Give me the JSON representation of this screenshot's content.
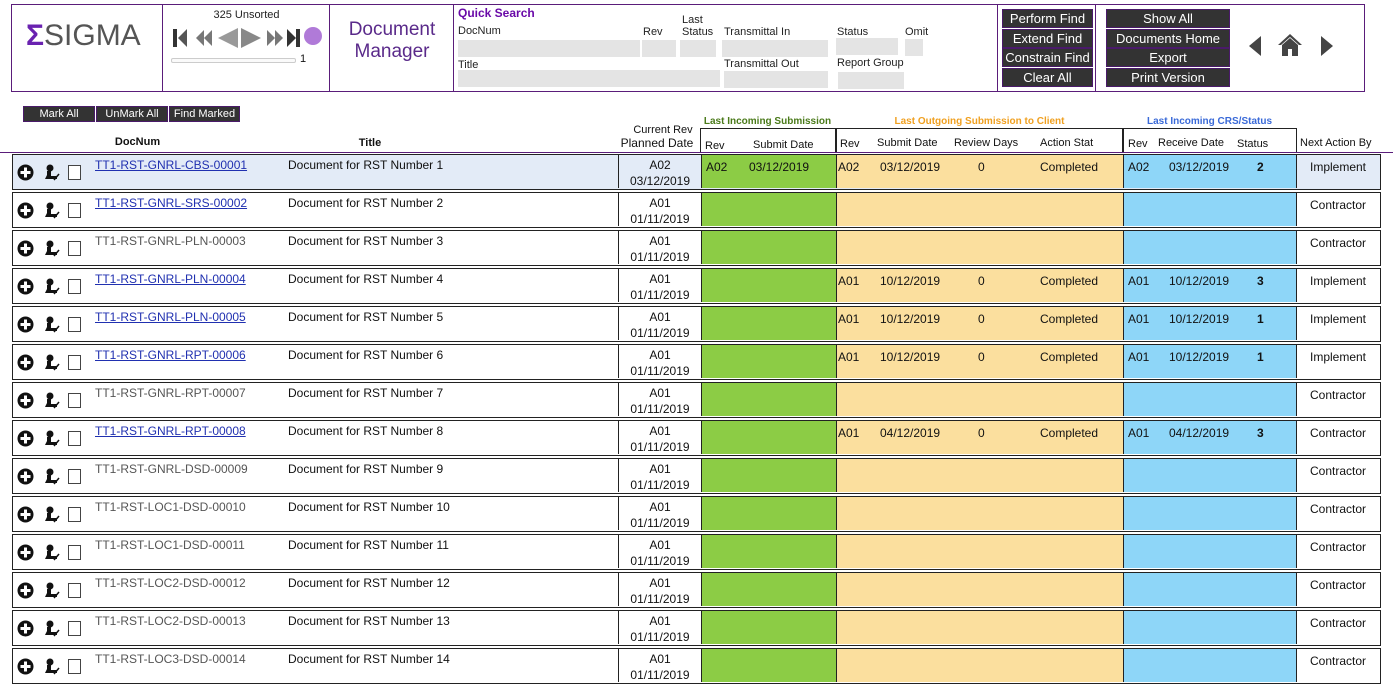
{
  "header": {
    "logo_sigma": "Σ",
    "logo_text": "SIGMA",
    "record_status": "325 Unsorted",
    "record_number": "1",
    "app_title_line1": "Document",
    "app_title_line2": "Manager"
  },
  "quick_search": {
    "title": "Quick Search",
    "labels": {
      "docnum": "DocNum",
      "rev": "Rev",
      "last_status_1": "Last",
      "last_status_2": "Status",
      "transmittal_in": "Transmittal In",
      "status": "Status",
      "omit": "Omit",
      "title": "Title",
      "transmittal_out": "Transmittal Out",
      "report_group": "Report Group"
    },
    "values": {
      "docnum": "",
      "rev": "",
      "last_status": "",
      "transmittal_in": "",
      "status": "",
      "omit": "",
      "title": "",
      "transmittal_out": "",
      "report_group": ""
    }
  },
  "find_buttons": [
    "Perform Find",
    "Extend Find",
    "Constrain Find",
    "Clear All"
  ],
  "action_buttons": [
    "Show All",
    "Documents Home",
    "Export",
    "Print Version"
  ],
  "icons": {
    "nav_prev": "triangle-left-icon",
    "home": "home-icon",
    "nav_next": "triangle-right-icon"
  },
  "mark_buttons": [
    "Mark All",
    "UnMark All",
    "Find Marked"
  ],
  "columns": {
    "docnum": "DocNum",
    "title": "Title",
    "current_rev": "Current Rev",
    "planned_date": "Planned Date",
    "group_incoming": "Last Incoming Submission",
    "group_outgoing": "Last Outgoing Submission to Client",
    "group_crs": "Last Incoming CRS/Status",
    "in_rev": "Rev",
    "in_submit_date": "Submit Date",
    "out_rev": "Rev",
    "out_submit_date": "Submit Date",
    "out_review_days": "Review Days",
    "out_action_stat": "Action Stat",
    "crs_rev": "Rev",
    "crs_receive_date": "Receive Date",
    "crs_status": "Status",
    "next_action_by": "Next Action By"
  },
  "colors": {
    "brand_purple": "#5a1d7a",
    "incoming_green": "#8ccc45",
    "outgoing_orange": "#fbdf9e",
    "crs_blue": "#8ed6f8",
    "incoming_header": "#4a7a1a",
    "outgoing_header": "#f0a020",
    "crs_header": "#3a6ad8"
  },
  "rows": [
    {
      "docnum": "TT1-RST-GNRL-CBS-00001",
      "link": true,
      "title": "Document for RST Number 1",
      "cur_rev": "A02",
      "planned": "03/12/2019",
      "in_rev": "A02",
      "in_date": "03/12/2019",
      "out_rev": "A02",
      "out_date": "03/12/2019",
      "out_days": "0",
      "out_stat": "Completed",
      "crs_rev": "A02",
      "crs_date": "03/12/2019",
      "crs_status": "2",
      "next": "Implement"
    },
    {
      "docnum": "TT1-RST-GNRL-SRS-00002",
      "link": true,
      "title": "Document for RST Number 2",
      "cur_rev": "A01",
      "planned": "01/11/2019",
      "in_rev": "",
      "in_date": "",
      "out_rev": "",
      "out_date": "",
      "out_days": "",
      "out_stat": "",
      "crs_rev": "",
      "crs_date": "",
      "crs_status": "",
      "next": "Contractor"
    },
    {
      "docnum": "TT1-RST-GNRL-PLN-00003",
      "link": false,
      "title": "Document for RST Number 3",
      "cur_rev": "A01",
      "planned": "01/11/2019",
      "in_rev": "",
      "in_date": "",
      "out_rev": "",
      "out_date": "",
      "out_days": "",
      "out_stat": "",
      "crs_rev": "",
      "crs_date": "",
      "crs_status": "",
      "next": "Contractor"
    },
    {
      "docnum": "TT1-RST-GNRL-PLN-00004",
      "link": true,
      "title": "Document for RST Number 4",
      "cur_rev": "A01",
      "planned": "01/11/2019",
      "in_rev": "",
      "in_date": "",
      "out_rev": "A01",
      "out_date": "10/12/2019",
      "out_days": "0",
      "out_stat": "Completed",
      "crs_rev": "A01",
      "crs_date": "10/12/2019",
      "crs_status": "3",
      "next": "Implement"
    },
    {
      "docnum": "TT1-RST-GNRL-PLN-00005",
      "link": true,
      "title": "Document for RST Number 5",
      "cur_rev": "A01",
      "planned": "01/11/2019",
      "in_rev": "",
      "in_date": "",
      "out_rev": "A01",
      "out_date": "10/12/2019",
      "out_days": "0",
      "out_stat": "Completed",
      "crs_rev": "A01",
      "crs_date": "10/12/2019",
      "crs_status": "1",
      "next": "Implement"
    },
    {
      "docnum": "TT1-RST-GNRL-RPT-00006",
      "link": true,
      "title": "Document for RST Number 6",
      "cur_rev": "A01",
      "planned": "01/11/2019",
      "in_rev": "",
      "in_date": "",
      "out_rev": "A01",
      "out_date": "10/12/2019",
      "out_days": "0",
      "out_stat": "Completed",
      "crs_rev": "A01",
      "crs_date": "10/12/2019",
      "crs_status": "1",
      "next": "Implement"
    },
    {
      "docnum": "TT1-RST-GNRL-RPT-00007",
      "link": false,
      "title": "Document for RST Number 7",
      "cur_rev": "A01",
      "planned": "01/11/2019",
      "in_rev": "",
      "in_date": "",
      "out_rev": "",
      "out_date": "",
      "out_days": "",
      "out_stat": "",
      "crs_rev": "",
      "crs_date": "",
      "crs_status": "",
      "next": "Contractor"
    },
    {
      "docnum": "TT1-RST-GNRL-RPT-00008",
      "link": true,
      "title": "Document for RST Number 8",
      "cur_rev": "A01",
      "planned": "01/11/2019",
      "in_rev": "",
      "in_date": "",
      "out_rev": "A01",
      "out_date": "04/12/2019",
      "out_days": "0",
      "out_stat": "Completed",
      "crs_rev": "A01",
      "crs_date": "04/12/2019",
      "crs_status": "3",
      "next": "Contractor"
    },
    {
      "docnum": "TT1-RST-GNRL-DSD-00009",
      "link": false,
      "title": "Document for RST Number 9",
      "cur_rev": "A01",
      "planned": "01/11/2019",
      "in_rev": "",
      "in_date": "",
      "out_rev": "",
      "out_date": "",
      "out_days": "",
      "out_stat": "",
      "crs_rev": "",
      "crs_date": "",
      "crs_status": "",
      "next": "Contractor"
    },
    {
      "docnum": "TT1-RST-LOC1-DSD-00010",
      "link": false,
      "title": "Document for RST Number 10",
      "cur_rev": "A01",
      "planned": "01/11/2019",
      "in_rev": "",
      "in_date": "",
      "out_rev": "",
      "out_date": "",
      "out_days": "",
      "out_stat": "",
      "crs_rev": "",
      "crs_date": "",
      "crs_status": "",
      "next": "Contractor"
    },
    {
      "docnum": "TT1-RST-LOC1-DSD-00011",
      "link": false,
      "title": "Document for RST Number 11",
      "cur_rev": "A01",
      "planned": "01/11/2019",
      "in_rev": "",
      "in_date": "",
      "out_rev": "",
      "out_date": "",
      "out_days": "",
      "out_stat": "",
      "crs_rev": "",
      "crs_date": "",
      "crs_status": "",
      "next": "Contractor"
    },
    {
      "docnum": "TT1-RST-LOC2-DSD-00012",
      "link": false,
      "title": "Document for RST Number 12",
      "cur_rev": "A01",
      "planned": "01/11/2019",
      "in_rev": "",
      "in_date": "",
      "out_rev": "",
      "out_date": "",
      "out_days": "",
      "out_stat": "",
      "crs_rev": "",
      "crs_date": "",
      "crs_status": "",
      "next": "Contractor"
    },
    {
      "docnum": "TT1-RST-LOC2-DSD-00013",
      "link": false,
      "title": "Document for RST Number 13",
      "cur_rev": "A01",
      "planned": "01/11/2019",
      "in_rev": "",
      "in_date": "",
      "out_rev": "",
      "out_date": "",
      "out_days": "",
      "out_stat": "",
      "crs_rev": "",
      "crs_date": "",
      "crs_status": "",
      "next": "Contractor"
    },
    {
      "docnum": "TT1-RST-LOC3-DSD-00014",
      "link": false,
      "title": "Document for RST Number 14",
      "cur_rev": "A01",
      "planned": "01/11/2019",
      "in_rev": "",
      "in_date": "",
      "out_rev": "",
      "out_date": "",
      "out_days": "",
      "out_stat": "",
      "crs_rev": "",
      "crs_date": "",
      "crs_status": "",
      "next": "Contractor"
    }
  ]
}
